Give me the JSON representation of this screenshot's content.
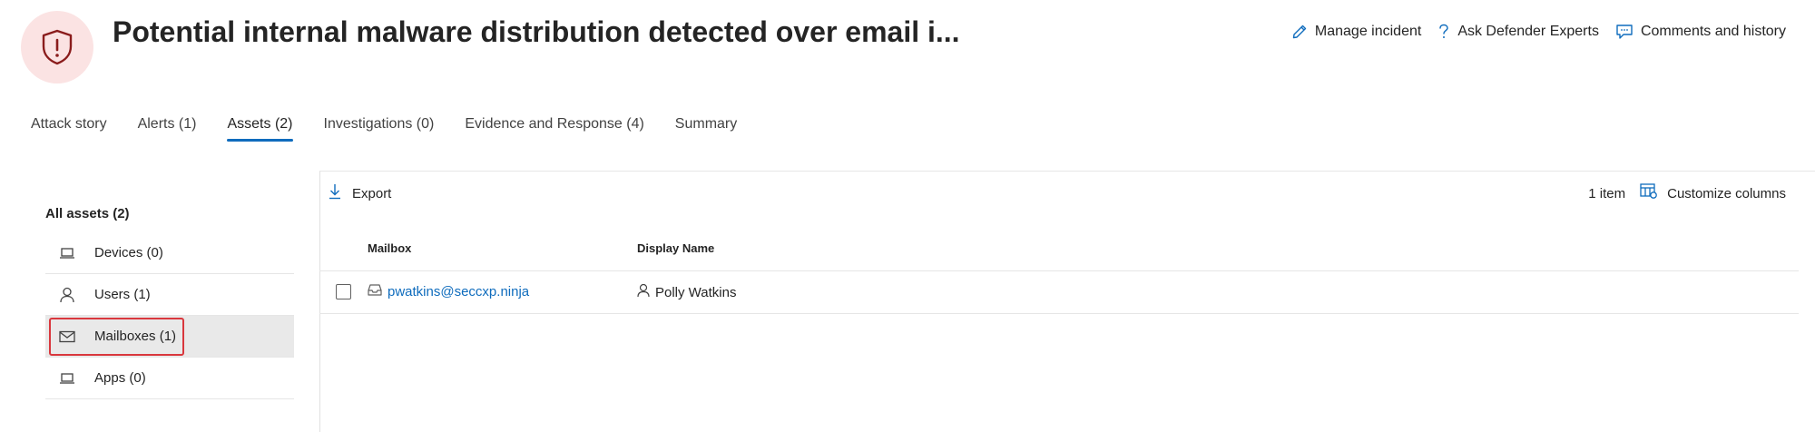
{
  "header": {
    "title": "Potential internal malware distribution detected over email i...",
    "actions": {
      "manage": "Manage incident",
      "ask": "Ask Defender Experts",
      "comments": "Comments and history"
    }
  },
  "tabs": [
    {
      "label": "Attack story"
    },
    {
      "label": "Alerts (1)"
    },
    {
      "label": "Assets (2)",
      "active": true
    },
    {
      "label": "Investigations (0)"
    },
    {
      "label": "Evidence and Response (4)"
    },
    {
      "label": "Summary"
    }
  ],
  "sidebar": {
    "title": "All assets (2)",
    "items": [
      {
        "label": "Devices (0)",
        "icon": "laptop-icon"
      },
      {
        "label": "Users (1)",
        "icon": "person-icon"
      },
      {
        "label": "Mailboxes (1)",
        "icon": "mail-icon",
        "selected": true
      },
      {
        "label": "Apps (0)",
        "icon": "laptop-icon"
      }
    ]
  },
  "toolbar": {
    "export_label": "Export",
    "item_count": "1 item",
    "customize_label": "Customize columns"
  },
  "table": {
    "columns": [
      "Mailbox",
      "Display Name"
    ],
    "rows": [
      {
        "mailbox": "pwatkins@seccxp.ninja",
        "display_name": "Polly Watkins"
      }
    ]
  },
  "colors": {
    "accent": "#0f6cbd",
    "danger": "#c4262e",
    "danger_bg": "#fbe3e3",
    "highlight_border": "#d9373d"
  }
}
